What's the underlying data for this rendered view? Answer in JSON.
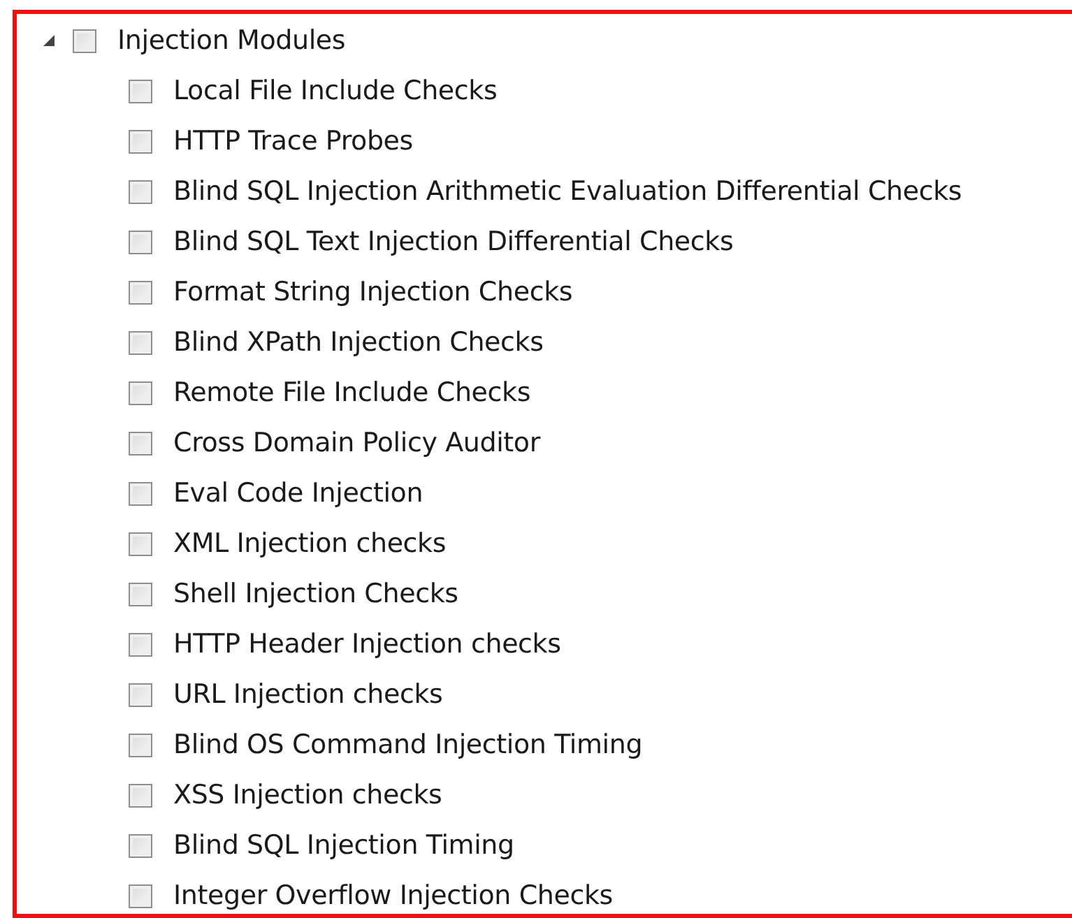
{
  "tree": [
    {
      "label": "Injection Modules",
      "checked": false,
      "expanded": true,
      "children": [
        {
          "label": "Local File Include Checks",
          "checked": false
        },
        {
          "label": "HTTP Trace Probes",
          "checked": false
        },
        {
          "label": "Blind SQL Injection Arithmetic Evaluation Differential Checks",
          "checked": false
        },
        {
          "label": "Blind SQL Text Injection Differential Checks",
          "checked": false
        },
        {
          "label": "Format String Injection Checks",
          "checked": false
        },
        {
          "label": "Blind XPath Injection Checks",
          "checked": false
        },
        {
          "label": "Remote File Include Checks",
          "checked": false
        },
        {
          "label": "Cross Domain Policy Auditor",
          "checked": false
        },
        {
          "label": "Eval Code Injection",
          "checked": false
        },
        {
          "label": "XML Injection checks",
          "checked": false
        },
        {
          "label": "Shell Injection Checks",
          "checked": false
        },
        {
          "label": "HTTP Header Injection checks",
          "checked": false
        },
        {
          "label": "URL Injection checks",
          "checked": false
        },
        {
          "label": "Blind OS Command Injection Timing",
          "checked": false
        },
        {
          "label": "XSS Injection checks",
          "checked": false
        },
        {
          "label": "Blind SQL Injection Timing",
          "checked": false
        },
        {
          "label": "Integer Overflow Injection Checks",
          "checked": false
        }
      ]
    }
  ]
}
